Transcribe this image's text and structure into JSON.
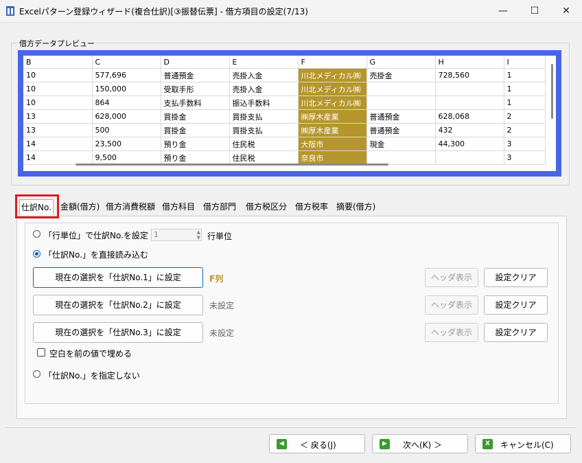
{
  "window": {
    "title": "Excelパターン登録ウィザード(複合仕訳)[③振替伝票] - 借方項目の設定(7/13)",
    "minimize": "—",
    "maximize": "☐",
    "close": "✕"
  },
  "preview": {
    "label": "借方データプレビュー",
    "columns": [
      "B",
      "C",
      "D",
      "E",
      "F",
      "G",
      "H",
      "I"
    ],
    "rows": [
      [
        "10",
        "577,696",
        "普通預金",
        "売掛入金",
        "川北メディカル㈱",
        "売掛金",
        "728,560",
        "1"
      ],
      [
        "10",
        "150,000",
        "受取手形",
        "売掛入金",
        "川北メディカル㈱",
        "",
        "",
        "1"
      ],
      [
        "10",
        "864",
        "支払手数料",
        "振込手数料",
        "川北メディカル㈱",
        "",
        "",
        "1"
      ],
      [
        "13",
        "628,000",
        "買掛金",
        "買掛支払",
        "㈱厚木産業",
        "普通預金",
        "628,068",
        "2"
      ],
      [
        "13",
        "500",
        "買掛金",
        "買掛支払",
        "㈱厚木産業",
        "普通預金",
        "432",
        "2"
      ],
      [
        "14",
        "23,500",
        "預り金",
        "住民税",
        "大阪市",
        "現金",
        "44,300",
        "3"
      ],
      [
        "14",
        "9,500",
        "預り金",
        "住民税",
        "奈良市",
        "",
        "",
        "3"
      ]
    ],
    "highlight_column": "F"
  },
  "tabs": [
    "仕訳No.",
    "金額(借方)",
    "借方消費税額",
    "借方科目",
    "借方部門",
    "借方税区分",
    "借方税率",
    "摘要(借方)"
  ],
  "active_tab": "仕訳No.",
  "options": {
    "radio_row_unit": "「行単位」で仕訳No.を設定",
    "spin_value": "1",
    "row_unit_suffix": "行単位",
    "radio_direct": "「仕訳No.」を直接読み込む",
    "radio_none": "「仕訳No.」を指定しない",
    "fill_blank": "空白を前の値で埋める"
  },
  "assign_rows": [
    {
      "button": "現在の選択を「仕訳No.1」に設定",
      "status": "F列",
      "header_btn": "ヘッダ表示",
      "clear_btn": "設定クリア"
    },
    {
      "button": "現在の選択を「仕訳No.2」に設定",
      "status": "未設定",
      "header_btn": "ヘッダ表示",
      "clear_btn": "設定クリア"
    },
    {
      "button": "現在の選択を「仕訳No.3」に設定",
      "status": "未設定",
      "header_btn": "ヘッダ表示",
      "clear_btn": "設定クリア"
    }
  ],
  "footer": {
    "back": "＜ 戻る(J)",
    "next": "次へ(K) ＞",
    "cancel": "キャンセル(C)"
  },
  "colors": {
    "accent_blue": "#4a64e6",
    "highlight_gold": "#b5962a",
    "red_box": "#e01b24",
    "icon_green": "#3a9a2e"
  }
}
